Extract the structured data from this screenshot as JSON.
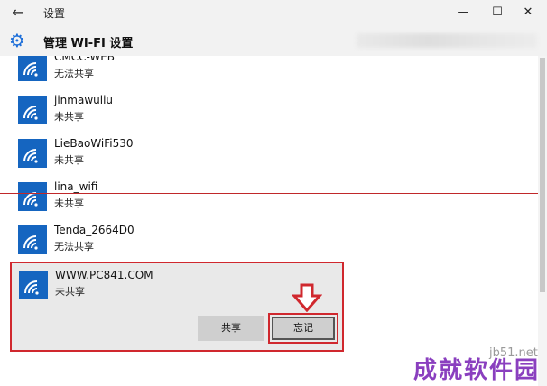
{
  "window": {
    "title": "设置",
    "back_glyph": "←",
    "min_glyph": "—",
    "max_glyph": "☐",
    "close_glyph": "✕"
  },
  "header": {
    "title": "管理 WI-FI 设置",
    "icon": "gear-icon"
  },
  "networks": [
    {
      "ssid": "CMCC-WEB",
      "status": "无法共享"
    },
    {
      "ssid": "jinmawuliu",
      "status": "未共享"
    },
    {
      "ssid": "LieBaoWiFi530",
      "status": "未共享"
    },
    {
      "ssid": "lina_wifi",
      "status": "未共享"
    },
    {
      "ssid": "Tenda_2664D0",
      "status": "无法共享"
    }
  ],
  "selected_network": {
    "ssid": "WWW.PC841.COM",
    "status": "未共享",
    "share_label": "共享",
    "forget_label": "忘记"
  },
  "watermark": {
    "text": "成就软件园",
    "site": "jb51.net"
  },
  "colors": {
    "accent": "#1565c0",
    "highlight": "#d0282e",
    "watermark": "#8a3fbf"
  }
}
